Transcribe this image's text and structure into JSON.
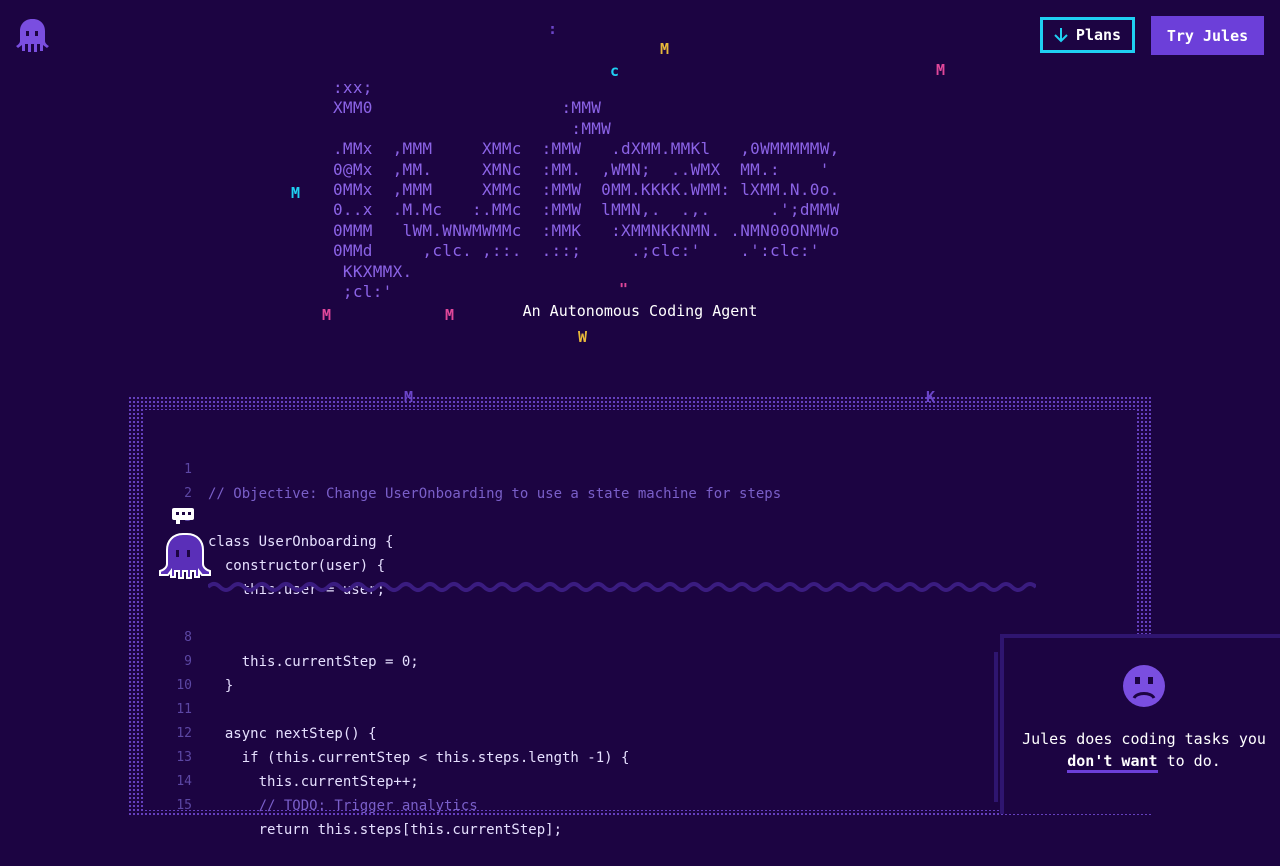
{
  "header": {
    "plans_label": "Plans",
    "try_label": "Try Jules"
  },
  "hero": {
    "ascii_logo": ":xx;\nXMM0                   :MMW\n                        :MMW\n.MMx  ,MMM     XMMc  :MMW   .dXMM.MMKl   ,0WMMMMMW,\n0@Mx  ,MM.     XMNc  :MM.  ,WMN;  ..WMX  MM.:    '\n0MMx  ,MMM     XMMc  :MMW  0MM.KKKK.WMM: lXMM.N.0o.\n0..x  .M.Mc   :.MMc  :MMW  lMMN,.  .,.      .';dMMW\n0MMM   lWM.WNWMWMMc  :MMK   :XMMNKKNMN. .NMN00ONMWo\n0MMd     ,clc. ,::.  .::;     .;clc:'    .':clc:'\n KKXMMX.\n ;cl:'",
    "tagline": "An Autonomous Coding Agent",
    "scatter_glyphs": [
      ":",
      "M",
      "c",
      "M",
      "M",
      "M",
      "M",
      "W",
      "\"",
      "M",
      "K"
    ]
  },
  "editor": {
    "lines": [
      {
        "n": "1",
        "text": "// Objective: Change UserOnboarding to use a state machine for steps"
      },
      {
        "n": "2",
        "text": ""
      },
      {
        "n": "3",
        "text": "class UserOnboarding {"
      },
      {
        "n": "",
        "text": "  constructor(user) {"
      },
      {
        "n": "",
        "text": "    this.user = user;"
      },
      {
        "n": "8",
        "text": "    this.currentStep = 0;"
      },
      {
        "n": "9",
        "text": "  }"
      },
      {
        "n": "10",
        "text": ""
      },
      {
        "n": "11",
        "text": "  async nextStep() {"
      },
      {
        "n": "12",
        "text": "    if (this.currentStep < this.steps.length -1) {"
      },
      {
        "n": "13",
        "text": "      this.currentStep++;"
      },
      {
        "n": "14",
        "text": "      // TODO: Trigger analytics"
      },
      {
        "n": "15",
        "text": "      return this.steps[this.currentStep];"
      }
    ]
  },
  "panel": {
    "text_before": "Jules does coding tasks you",
    "emphasis": "don't want",
    "text_after": " to do."
  },
  "colors": {
    "background": "#1c0442",
    "accent": "#6c3fd9",
    "cyan": "#1fd0f2",
    "yellow": "#e8b83a",
    "pink": "#e0479a"
  },
  "icons": [
    "octopus-logo-icon",
    "arrow-down-icon",
    "octopus-mascot-icon",
    "sad-face-icon"
  ]
}
